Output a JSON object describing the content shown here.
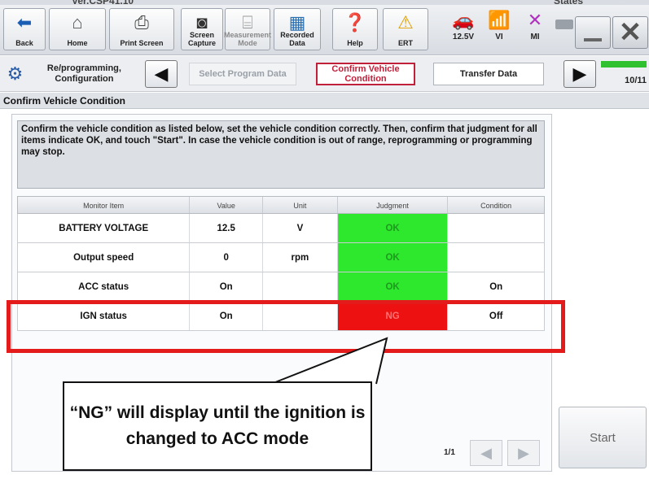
{
  "window": {
    "version": "Ver.CSP41.10",
    "states_label": "States"
  },
  "toolbar": {
    "buttons": [
      {
        "label": "Back",
        "icon": "back-arrow-icon"
      },
      {
        "label": "Home",
        "icon": "home-icon"
      },
      {
        "label": "Print Screen",
        "icon": "printer-icon"
      },
      {
        "label": "Screen Capture",
        "icon": "camera-icon"
      },
      {
        "label": "Measurement Mode",
        "icon": "measurement-icon"
      },
      {
        "label": "Recorded Data",
        "icon": "recorded-data-icon"
      },
      {
        "label": "Help",
        "icon": "help-icon"
      },
      {
        "label": "ERT",
        "icon": "warning-icon"
      }
    ],
    "status": [
      {
        "label": "12.5V",
        "icon": "car-battery-icon"
      },
      {
        "label": "VI",
        "icon": "signal-icon"
      },
      {
        "label": "MI",
        "icon": "mi-cross-icon"
      }
    ]
  },
  "stepbar": {
    "reprog_label": "Re/programming, Configuration",
    "steps": [
      {
        "label": "Select Program Data",
        "state": "inactive"
      },
      {
        "label": "Confirm Vehicle Condition",
        "state": "active"
      },
      {
        "label": "Transfer Data",
        "state": "next"
      }
    ],
    "progress_text": "10/11",
    "progress_fraction": 0.909
  },
  "section_title": "Confirm Vehicle Condition",
  "instructions": "Confirm the vehicle condition as listed below, set the vehicle condition correctly. Then, confirm that judgment for all items indicate OK, and touch \"Start\". In case the vehicle condition is out of range, reprogramming or programming may stop.",
  "table": {
    "headers": [
      "Monitor Item",
      "Value",
      "Unit",
      "Judgment",
      "Condition"
    ],
    "rows": [
      [
        "BATTERY VOLTAGE",
        "12.5",
        "V",
        "OK",
        ""
      ],
      [
        "Output speed",
        "0",
        "rpm",
        "OK",
        ""
      ],
      [
        "ACC status",
        "On",
        "",
        "OK",
        "On"
      ],
      [
        "IGN status",
        "On",
        "",
        "NG",
        "Off"
      ]
    ]
  },
  "pager": {
    "page_text": "1/1"
  },
  "start_label": "Start",
  "callout_text": "“NG” will display until the ignition is changed to ACC mode"
}
